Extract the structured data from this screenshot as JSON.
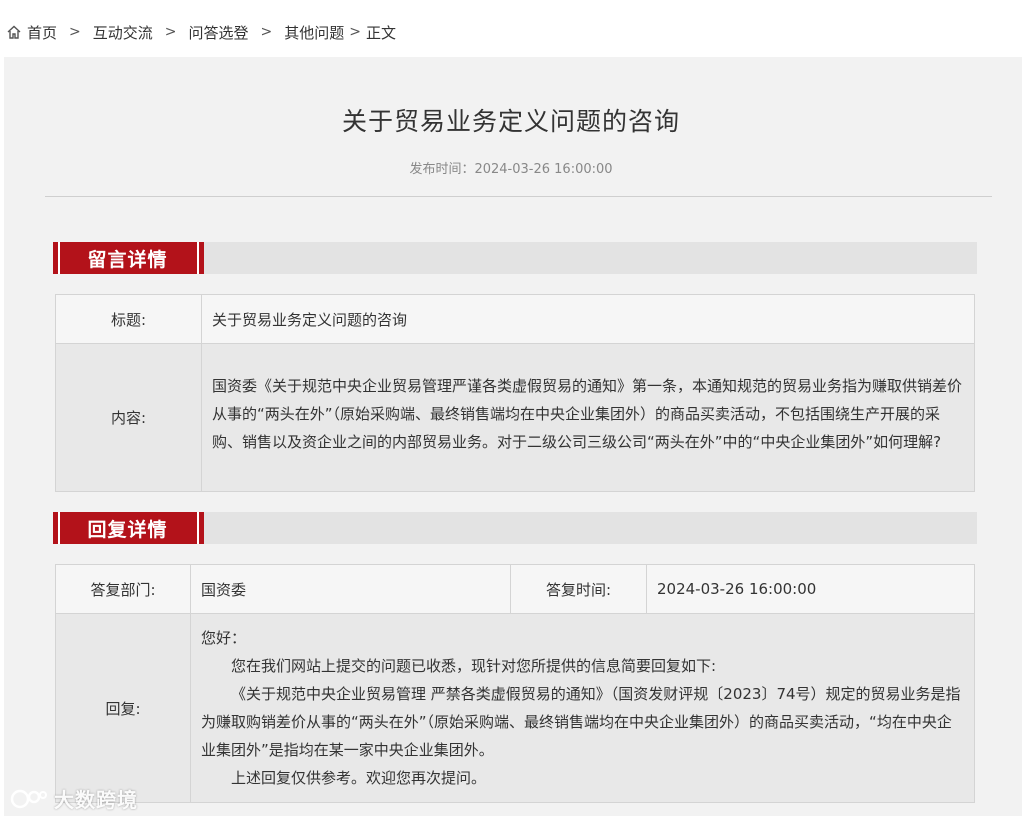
{
  "breadcrumb": {
    "items": [
      "首页",
      "互动交流",
      "问答选登",
      "其他问题",
      "正文"
    ],
    "separator": ">"
  },
  "article": {
    "title": "关于贸易业务定义问题的咨询",
    "publish_label": "发布时间：",
    "publish_time": "2024-03-26 16:00:00"
  },
  "message_section": {
    "heading": "留言详情",
    "title_label": "标题:",
    "title_value": "关于贸易业务定义问题的咨询",
    "content_label": "内容:",
    "content_value": "国资委《关于规范中央企业贸易管理严谨各类虚假贸易的通知》第一条，本通知规范的贸易业务指为赚取供销差价从事的“两头在外”（原始采购端、最终销售端均在中央企业集团外）的商品买卖活动，不包括围绕生产开展的采购、销售以及资企业之间的内部贸易业务。对于二级公司三级公司“两头在外”中的“中央企业集团外”如何理解?"
  },
  "reply_section": {
    "heading": "回复详情",
    "dept_label": "答复部门:",
    "dept_value": "国资委",
    "time_label": "答复时间:",
    "time_value": "2024-03-26 16:00:00",
    "reply_label": "回复:",
    "reply_lines": [
      "您好：",
      "您在我们网站上提交的问题已收悉，现针对您所提供的信息简要回复如下:",
      "《关于规范中央企业贸易管理 严禁各类虚假贸易的通知》（国资发财评规〔2023〕74号）规定的贸易业务是指为赚取购销差价从事的“两头在外”（原始采购端、最终销售端均在中央企业集团外）的商品买卖活动，“均在中央企业集团外”是指均在某一家中央企业集团外。",
      "上述回复仅供参考。欢迎您再次提问。"
    ]
  },
  "watermark": {
    "text": "大数跨境"
  },
  "colors": {
    "accent_red": "#b3121a",
    "panel_bg": "#f2f2f2"
  }
}
